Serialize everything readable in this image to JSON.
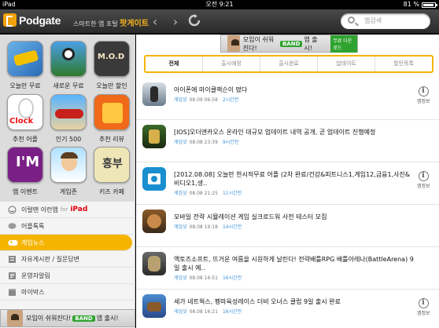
{
  "status": {
    "device": "iPad",
    "time": "오전 9:21",
    "battery": "81 %"
  },
  "header": {
    "logo": "Podgate",
    "tagline_prefix": "스마트한 앱 포털",
    "tagline_brand": "팟게이트",
    "search_placeholder": "앱검색"
  },
  "sidebar": {
    "apps": [
      {
        "label": "오늘만 무료"
      },
      {
        "label": "새로운 무료"
      },
      {
        "label": "오늘만 할인"
      },
      {
        "label": "추천 어플"
      },
      {
        "label": "인기 500"
      },
      {
        "label": "추천 리뷰"
      },
      {
        "label": "앱 이벤트"
      },
      {
        "label": "게임존"
      },
      {
        "label": "키즈 카페"
      }
    ],
    "menu": [
      {
        "label": "이럴땐 이런앱",
        "for": "for",
        "ipad": "iPad"
      },
      {
        "label": "어플톡톡"
      },
      {
        "label": "게임뉴스"
      },
      {
        "label": "자유게시판 / 질문답변"
      },
      {
        "label": "운영자알림"
      },
      {
        "label": "마이박스"
      }
    ]
  },
  "banner": {
    "text_a": "모임이 쉬워진다!",
    "band": "BAND",
    "text_b": "앱 출시!",
    "cta": "무료 다운로드"
  },
  "tabs": [
    "전체",
    "출시예정",
    "출시완료",
    "업데이트",
    "할인목록"
  ],
  "news": [
    {
      "title": "아이폰에 마이클잭슨이 떴다",
      "cat": "게임샷",
      "date": "08.09 06:58",
      "ago": "2시간전",
      "info": "앱정보"
    },
    {
      "title": "[IOS]오더앤카오스 온라인 대규모 업데이트 내역 공개, 곧 업데이트 진행예정",
      "cat": "게임샷",
      "date": "08.08 23:39",
      "ago": "9시간전",
      "info": ""
    },
    {
      "title": "[2012.08.08] 오늘만 한시적무료 어플 (2차 완료/건강&피트니스1,게임12,금융1,사진&비디오1,생..",
      "cat": "게임샷",
      "date": "08.08 21:25",
      "ago": "11시간전",
      "info": "앱정보"
    },
    {
      "title": "모바일 전략 시뮬레이션 게임 실크로드워 사전 테스터 모집",
      "cat": "게임샷",
      "date": "08.08 19:18",
      "ago": "14시간전",
      "info": ""
    },
    {
      "title": "액토즈소프트, 뜨거운 여름을 시원하게 날린다! 전략배틀RPG 배틀아레나(BattleArena) 9일 출시 예..",
      "cat": "게임샷",
      "date": "08.08 16:51",
      "ago": "16시간전",
      "info": ""
    },
    {
      "title": "세가 네트웍스, 펭마육성레이스 더비 오너스 클럽 9일 출시 완료",
      "cat": "게임샷",
      "date": "08.08 16:21",
      "ago": "16시간전",
      "info": "앱정보"
    }
  ]
}
